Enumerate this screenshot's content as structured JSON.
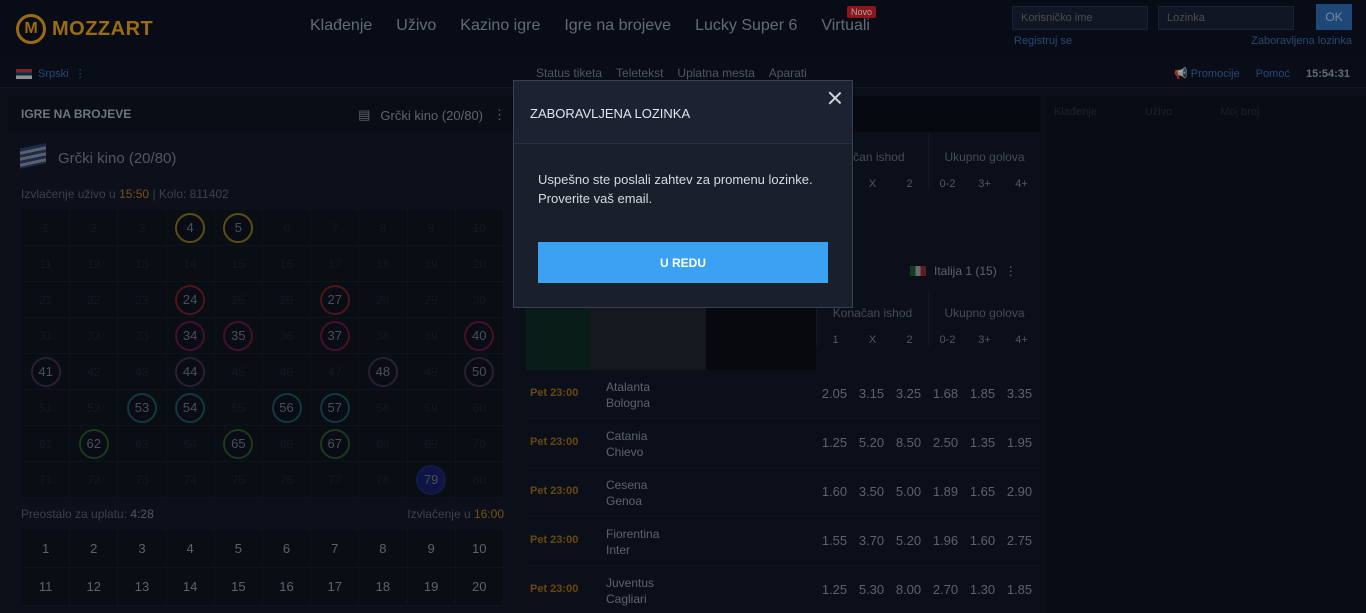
{
  "header": {
    "logo_text": "MOZZART",
    "nav": [
      {
        "label": "Klađenje"
      },
      {
        "label": "Uživo"
      },
      {
        "label": "Kazino igre"
      },
      {
        "label": "Igre na brojeve"
      },
      {
        "label": "Lucky Super 6"
      },
      {
        "label": "Virtuali",
        "badge": "Novo"
      }
    ],
    "login": {
      "username_placeholder": "Korisničko ime",
      "password_placeholder": "Lozinka",
      "ok_label": "OK",
      "register_label": "Registruj se",
      "forgot_label": "Zaboravljena lozinka"
    }
  },
  "subbar": {
    "language": "Srpski",
    "links": [
      "Status tiketa",
      "Teletekst",
      "Uplatna mesta",
      "Aparati"
    ],
    "promotions": "Promocije",
    "help": "Pomoć",
    "clock": "15:54:31"
  },
  "keno": {
    "section_title": "IGRE NA BROJEVE",
    "selected_game": "Grčki kino (20/80)",
    "game_title": "Grčki kino (20/80)",
    "draw_live_label": "Izvlačenje uživo u",
    "draw_live_time": "15:50",
    "round_label": "| Kolo:",
    "round_number": "811402",
    "drawn": [
      {
        "n": 4,
        "c": "yellow"
      },
      {
        "n": 5,
        "c": "yellow"
      },
      {
        "n": 24,
        "c": "red"
      },
      {
        "n": 27,
        "c": "red"
      },
      {
        "n": 34,
        "c": "magenta"
      },
      {
        "n": 35,
        "c": "magenta"
      },
      {
        "n": 37,
        "c": "magenta"
      },
      {
        "n": 40,
        "c": "magenta"
      },
      {
        "n": 41,
        "c": "purple"
      },
      {
        "n": 44,
        "c": "purple"
      },
      {
        "n": 48,
        "c": "purple"
      },
      {
        "n": 50,
        "c": "purple"
      },
      {
        "n": 53,
        "c": "teal"
      },
      {
        "n": 54,
        "c": "teal"
      },
      {
        "n": 56,
        "c": "teal"
      },
      {
        "n": 57,
        "c": "teal"
      },
      {
        "n": 62,
        "c": "green"
      },
      {
        "n": 65,
        "c": "green"
      },
      {
        "n": 67,
        "c": "green"
      },
      {
        "n": 79,
        "c": "blue"
      }
    ],
    "remaining_label": "Preostalo za uplatu:",
    "remaining_time": "4:28",
    "next_draw_label": "Izvlačenje u",
    "next_draw_time": "16:00",
    "picker_numbers": [
      "1",
      "2",
      "3",
      "4",
      "5",
      "6",
      "7",
      "8",
      "9",
      "10",
      "11",
      "12",
      "13",
      "14",
      "15",
      "16",
      "17",
      "18",
      "19",
      "20"
    ]
  },
  "markets": {
    "final_outcome": "Konačan ishod",
    "final_outcome_short": "čačan ishod",
    "total_goals": "Ukupno golova",
    "cols_1x2": [
      "1",
      "X",
      "2"
    ],
    "cols_1x2_partial": [
      "X",
      "2"
    ],
    "cols_goals": [
      "0-2",
      "3+",
      "4+"
    ],
    "league": "Italija 1 (15)"
  },
  "matches": [
    {
      "time": "Pet 23:00",
      "home": "Atalanta",
      "away": "Bologna",
      "odds": [
        "2.05",
        "3.15",
        "3.25",
        "1.68",
        "1.85",
        "3.35"
      ]
    },
    {
      "time": "Pet 23:00",
      "home": "Catania",
      "away": "Chievo",
      "odds": [
        "1.25",
        "5.20",
        "8.50",
        "2.50",
        "1.35",
        "1.95"
      ]
    },
    {
      "time": "Pet 23:00",
      "home": "Cesena",
      "away": "Genoa",
      "odds": [
        "1.60",
        "3.50",
        "5.00",
        "1.89",
        "1.65",
        "2.90"
      ]
    },
    {
      "time": "Pet 23:00",
      "home": "Fiorentina",
      "away": "Inter",
      "odds": [
        "1.55",
        "3.70",
        "5.20",
        "1.96",
        "1.60",
        "2.75"
      ]
    },
    {
      "time": "Pet 23:00",
      "home": "Juventus",
      "away": "Cagliari",
      "odds": [
        "1.25",
        "5.30",
        "8.00",
        "2.70",
        "1.30",
        "1.85"
      ]
    }
  ],
  "betslip_tabs": [
    "Klađenje",
    "Uživo",
    "Moj broj"
  ],
  "modal": {
    "title": "ZABORAVLJENA LOZINKA",
    "line1": "Uspešno ste poslali zahtev za promenu lozinke.",
    "line2": "Proverite vaš email.",
    "button": "U REDU"
  }
}
